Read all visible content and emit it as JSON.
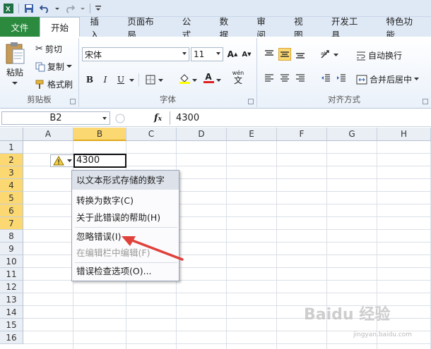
{
  "tabs": [
    "文件",
    "开始",
    "插入",
    "页面布局",
    "公式",
    "数据",
    "审阅",
    "视图",
    "开发工具",
    "特色功能"
  ],
  "clipboard": {
    "paste": "粘贴",
    "cut": "剪切",
    "copy": "复制",
    "format_painter": "格式刷",
    "group": "剪贴板"
  },
  "font": {
    "name": "宋体",
    "size": "11",
    "bold": "B",
    "italic": "I",
    "underline": "U",
    "group": "字体",
    "grow": "A",
    "shrink": "A",
    "color_a": "A",
    "phonetic": "wén",
    "phonetic_char": "文"
  },
  "alignment": {
    "wrap": "自动换行",
    "merge": "合并后居中",
    "group": "对齐方式"
  },
  "formula_bar": {
    "name_box": "B2",
    "fx": "fx",
    "content": "4300"
  },
  "columns": [
    "A",
    "B",
    "C",
    "D",
    "E",
    "F",
    "G",
    "H"
  ],
  "rows": [
    "1",
    "2",
    "3",
    "4",
    "5",
    "6",
    "7",
    "8",
    "9",
    "10",
    "11",
    "12",
    "13",
    "14",
    "15",
    "16"
  ],
  "cell_b2": "4300",
  "menu": {
    "header": "以文本形式存储的数字",
    "convert": "转换为数字(C)",
    "help": "关于此错误的帮助(H)",
    "ignore": "忽略错误(I)",
    "edit": "在编辑栏中编辑(F)",
    "options": "错误检查选项(O)..."
  },
  "watermark": {
    "brand": "Baidu 经验",
    "url": "jingyan.baidu.com"
  }
}
